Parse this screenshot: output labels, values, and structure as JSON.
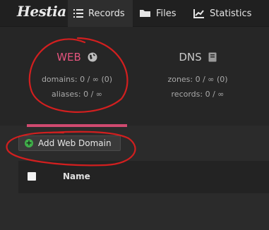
{
  "nav": {
    "logo": "Hestia",
    "items": [
      {
        "label": "Records"
      },
      {
        "label": "Files"
      },
      {
        "label": "Statistics"
      }
    ]
  },
  "stats": {
    "web": {
      "title": "WEB",
      "domains": "domains: 0 / ∞ (0)",
      "aliases": "aliases: 0 / ∞"
    },
    "dns": {
      "title": "DNS",
      "zones": "zones: 0 / ∞ (0)",
      "records": "records: 0 / ∞"
    }
  },
  "toolbar": {
    "add_label": "Add Web Domain"
  },
  "table": {
    "columns": [
      "Name"
    ]
  },
  "colors": {
    "accent": "#e4547e",
    "annotation": "#d21f1f",
    "add_icon": "#3fae49"
  }
}
